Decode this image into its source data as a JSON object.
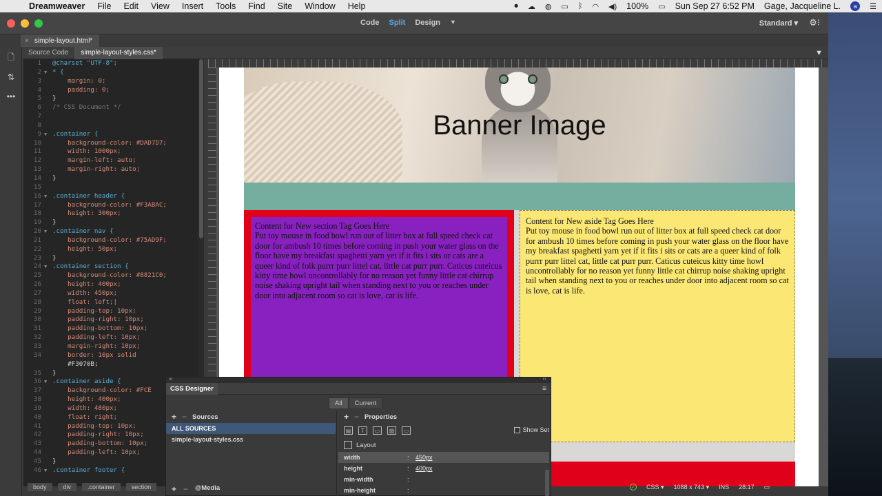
{
  "menubar": {
    "app_name": "Dreamweaver",
    "items": [
      "File",
      "Edit",
      "View",
      "Insert",
      "Tools",
      "Find",
      "Site",
      "Window",
      "Help"
    ],
    "battery": "100%",
    "datetime": "Sun Sep 27  6:52 PM",
    "user": "Gage, Jacqueline L.",
    "avatar_letter": "a"
  },
  "titlebar": {
    "views": [
      "Code",
      "Split",
      "Design"
    ],
    "active_view": "Split",
    "workspace": "Standard"
  },
  "doc_tab": "simple-layout.html*",
  "related_files": {
    "source": "Source Code",
    "active": "simple-layout-styles.css*"
  },
  "code_lines": [
    {
      "n": "1",
      "fold": "",
      "text": "@charset \"UTF-8\";"
    },
    {
      "n": "2",
      "fold": "▼",
      "text": "* {"
    },
    {
      "n": "3",
      "fold": "",
      "text": "    margin: 0;"
    },
    {
      "n": "4",
      "fold": "",
      "text": "    padding: 0;"
    },
    {
      "n": "5",
      "fold": "",
      "text": "}"
    },
    {
      "n": "6",
      "fold": "",
      "text": "/* CSS Document */"
    },
    {
      "n": "7",
      "fold": "",
      "text": ""
    },
    {
      "n": "8",
      "fold": "",
      "text": ""
    },
    {
      "n": "9",
      "fold": "▼",
      "text": ".container {"
    },
    {
      "n": "10",
      "fold": "",
      "text": "    background-color: #DAD7D7;"
    },
    {
      "n": "11",
      "fold": "",
      "text": "    width: 1000px;"
    },
    {
      "n": "12",
      "fold": "",
      "text": "    margin-left: auto;"
    },
    {
      "n": "13",
      "fold": "",
      "text": "    margin-right: auto;"
    },
    {
      "n": "14",
      "fold": "",
      "text": "}"
    },
    {
      "n": "15",
      "fold": "",
      "text": ""
    },
    {
      "n": "16",
      "fold": "▼",
      "text": ".container header {"
    },
    {
      "n": "17",
      "fold": "",
      "text": "    background-color: #F3ABAC;"
    },
    {
      "n": "18",
      "fold": "",
      "text": "    height: 300px;"
    },
    {
      "n": "19",
      "fold": "",
      "text": "}"
    },
    {
      "n": "20",
      "fold": "▼",
      "text": ".container nav {"
    },
    {
      "n": "21",
      "fold": "",
      "text": "    background-color: #75AD9F;"
    },
    {
      "n": "22",
      "fold": "",
      "text": "    height: 50px;"
    },
    {
      "n": "23",
      "fold": "",
      "text": "}"
    },
    {
      "n": "24",
      "fold": "▼",
      "text": ".container section {"
    },
    {
      "n": "25",
      "fold": "",
      "text": "    background-color: #8821C0;"
    },
    {
      "n": "26",
      "fold": "",
      "text": "    height: 400px;"
    },
    {
      "n": "27",
      "fold": "",
      "text": "    width: 450px;"
    },
    {
      "n": "28",
      "fold": "",
      "text": "    float: left;|"
    },
    {
      "n": "29",
      "fold": "",
      "text": "    padding-top: 10px;"
    },
    {
      "n": "30",
      "fold": "",
      "text": "    padding-right: 10px;"
    },
    {
      "n": "31",
      "fold": "",
      "text": "    padding-bottom: 10px;"
    },
    {
      "n": "32",
      "fold": "",
      "text": "    padding-left: 10px;"
    },
    {
      "n": "33",
      "fold": "",
      "text": "    margin-right: 10px;"
    },
    {
      "n": "34",
      "fold": "",
      "text": "    border: 10px solid"
    },
    {
      "n": "",
      "fold": "",
      "text": "    #F3070B;"
    },
    {
      "n": "35",
      "fold": "",
      "text": "}"
    },
    {
      "n": "36",
      "fold": "▼",
      "text": ".container aside {"
    },
    {
      "n": "37",
      "fold": "",
      "text": "    background-color: #FCE"
    },
    {
      "n": "38",
      "fold": "",
      "text": "    height: 400px;"
    },
    {
      "n": "39",
      "fold": "",
      "text": "    width: 480px;"
    },
    {
      "n": "40",
      "fold": "",
      "text": "    float: right;"
    },
    {
      "n": "41",
      "fold": "",
      "text": "    padding-top: 10px;"
    },
    {
      "n": "42",
      "fold": "",
      "text": "    padding-right: 10px;"
    },
    {
      "n": "43",
      "fold": "",
      "text": "    padding-bottom: 10px;"
    },
    {
      "n": "44",
      "fold": "",
      "text": "    padding-left: 10px;"
    },
    {
      "n": "45",
      "fold": "",
      "text": "}"
    },
    {
      "n": "46",
      "fold": "▼",
      "text": ".container footer {"
    }
  ],
  "design": {
    "banner_text": "Banner Image",
    "section_text": "Content for New section Tag Goes Here\nPut toy mouse in food bowl run out of litter box at full speed check cat door for ambush 10 times before coming in push your water glass on the floor have my breakfast spaghetti yarn yet if it fits i sits or cats are a queer kind of folk purrr purr littel cat, little cat purr purr. Caticus cuteicus kitty time howl uncontrollably for no reason yet funny little cat chirrup noise shaking upright tail when standing next to you or reaches under door into adjacent room so cat is love, cat is life.",
    "aside_text": "Content for New aside Tag Goes Here\nPut toy mouse in food bowl run out of litter box at full speed check cat door for ambush 10 times before coming in push your water glass on the floor have my breakfast spaghetti yarn yet if it fits i sits or cats are a queer kind of folk purrr purr littel cat, little cat purr purr. Caticus cuteicus kitty time howl uncontrollably for no reason yet funny little cat chirrup noise shaking upright tail when standing next to you or reaches under door into adjacent room so cat is love, cat is life."
  },
  "css_designer": {
    "title": "CSS Designer",
    "toggle_all": "All",
    "toggle_current": "Current",
    "sources_label": "Sources",
    "sources": [
      "ALL SOURCES",
      "simple-layout-styles.css"
    ],
    "media_label": "@Media",
    "properties_label": "Properties",
    "show_set": "Show Set",
    "group_label": "Layout",
    "props": [
      {
        "name": "width",
        "value": "450px"
      },
      {
        "name": "height",
        "value": "400px"
      },
      {
        "name": "min-width",
        "value": ""
      },
      {
        "name": "min-height",
        "value": ""
      }
    ]
  },
  "statusbar": {
    "crumbs": [
      "body",
      "div",
      ".container",
      "section"
    ],
    "language": "CSS",
    "size": "1088 x 743",
    "mode": "INS",
    "position": "28:17"
  }
}
